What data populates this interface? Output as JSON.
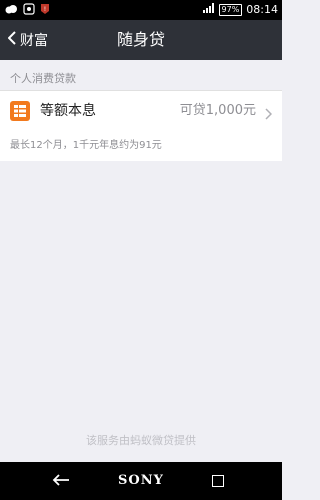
{
  "status_bar": {
    "time": "08:14",
    "battery": "97%"
  },
  "nav": {
    "back_label": "财富",
    "title": "随身贷"
  },
  "section": {
    "header": "个人消费贷款"
  },
  "loan": {
    "name": "等额本息",
    "amount": "可贷1,000元",
    "icon": "list-doc-icon",
    "icon_color": "#f27a1e"
  },
  "note": {
    "text": "最长12个月，1千元年息约为91元"
  },
  "footer": {
    "provider": "该服务由蚂蚁微贷提供"
  },
  "system_nav": {
    "brand": "SONY"
  }
}
